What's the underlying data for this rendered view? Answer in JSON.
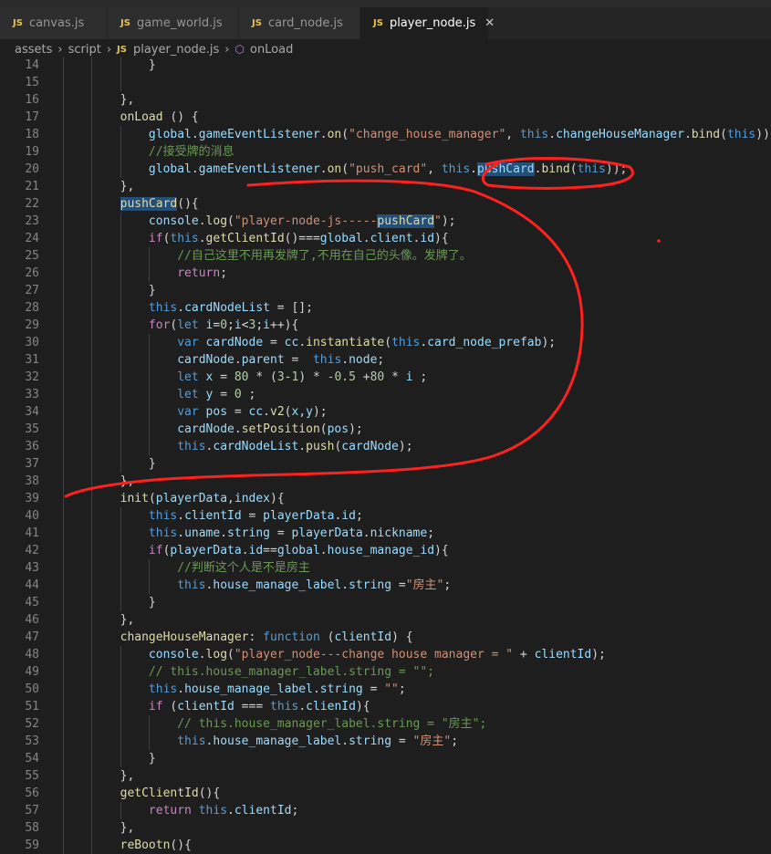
{
  "tabs": [
    {
      "icon": "JS",
      "label": "canvas.js"
    },
    {
      "icon": "JS",
      "label": "game_world.js"
    },
    {
      "icon": "JS",
      "label": "card_node.js"
    },
    {
      "icon": "JS",
      "label": "player_node.js",
      "active": true
    }
  ],
  "breadcrumb": [
    "assets",
    "script",
    "player_node.js",
    "onLoad"
  ],
  "colors": {
    "keyword": "#569cd6",
    "string": "#ce9178",
    "comment": "#6a9955",
    "function": "#dcdcaa",
    "variable": "#9cdcfe",
    "selection": "#264f78",
    "annotation": "#ff2020"
  },
  "lines": [
    {
      "n": "14",
      "t": [
        [
          "            ",
          "p"
        ],
        [
          "}",
          "p"
        ]
      ]
    },
    {
      "n": "15",
      "t": []
    },
    {
      "n": "16",
      "t": [
        [
          "        ",
          "p"
        ],
        [
          "},",
          "p"
        ]
      ]
    },
    {
      "n": "17",
      "t": [
        [
          "        ",
          "p"
        ],
        [
          "onLoad",
          "f"
        ],
        [
          " () {",
          "p"
        ]
      ]
    },
    {
      "n": "18",
      "t": [
        [
          "            ",
          "p"
        ],
        [
          "global",
          "v"
        ],
        [
          ".",
          "p"
        ],
        [
          "gameEventListener",
          "v"
        ],
        [
          ".",
          "p"
        ],
        [
          "on",
          "f"
        ],
        [
          "(",
          "p"
        ],
        [
          "\"change_house_manager\"",
          "s"
        ],
        [
          ", ",
          "p"
        ],
        [
          "this",
          "k"
        ],
        [
          ".",
          "p"
        ],
        [
          "changeHouseManager",
          "v"
        ],
        [
          ".",
          "p"
        ],
        [
          "bind",
          "f"
        ],
        [
          "(",
          "p"
        ],
        [
          "this",
          "k"
        ],
        [
          "));",
          "p"
        ]
      ]
    },
    {
      "n": "19",
      "t": [
        [
          "            ",
          "p"
        ],
        [
          "//接受牌的消息",
          "c"
        ]
      ]
    },
    {
      "n": "20",
      "t": [
        [
          "            ",
          "p"
        ],
        [
          "global",
          "v"
        ],
        [
          ".",
          "p"
        ],
        [
          "gameEventListener",
          "v"
        ],
        [
          ".",
          "p"
        ],
        [
          "on",
          "f"
        ],
        [
          "(",
          "p"
        ],
        [
          "\"push_card\"",
          "s"
        ],
        [
          ", ",
          "p"
        ],
        [
          "this",
          "k"
        ],
        [
          ".",
          "p"
        ],
        [
          "pushCard",
          "vh"
        ],
        [
          ".",
          "p"
        ],
        [
          "bind",
          "f"
        ],
        [
          "(",
          "p"
        ],
        [
          "this",
          "k"
        ],
        [
          "));",
          "p"
        ]
      ]
    },
    {
      "n": "21",
      "t": [
        [
          "        ",
          "p"
        ],
        [
          "},",
          "p"
        ]
      ]
    },
    {
      "n": "22",
      "t": [
        [
          "        ",
          "p"
        ],
        [
          "pushCard",
          "fh"
        ],
        [
          "(){",
          "p"
        ]
      ]
    },
    {
      "n": "23",
      "t": [
        [
          "            ",
          "p"
        ],
        [
          "console",
          "v"
        ],
        [
          ".",
          "p"
        ],
        [
          "log",
          "f"
        ],
        [
          "(",
          "p"
        ],
        [
          "\"player-node-js-----",
          "s"
        ],
        [
          "pushCard",
          "sh"
        ],
        [
          "\"",
          "s"
        ],
        [
          ");",
          "p"
        ]
      ]
    },
    {
      "n": "24",
      "t": [
        [
          "            ",
          "p"
        ],
        [
          "if",
          "x"
        ],
        [
          "(",
          "p"
        ],
        [
          "this",
          "k"
        ],
        [
          ".",
          "p"
        ],
        [
          "getClientId",
          "f"
        ],
        [
          "()===",
          "p"
        ],
        [
          "global",
          "v"
        ],
        [
          ".",
          "p"
        ],
        [
          "client",
          "v"
        ],
        [
          ".",
          "p"
        ],
        [
          "id",
          "v"
        ],
        [
          "){",
          "p"
        ]
      ]
    },
    {
      "n": "25",
      "t": [
        [
          "                ",
          "p"
        ],
        [
          "//自己这里不用再发牌了,不用在自己的头像。发牌了。",
          "c"
        ]
      ]
    },
    {
      "n": "26",
      "t": [
        [
          "                ",
          "p"
        ],
        [
          "return",
          "x"
        ],
        [
          ";",
          "p"
        ]
      ]
    },
    {
      "n": "27",
      "t": [
        [
          "            ",
          "p"
        ],
        [
          "}",
          "p"
        ]
      ]
    },
    {
      "n": "28",
      "t": [
        [
          "            ",
          "p"
        ],
        [
          "this",
          "k"
        ],
        [
          ".",
          "p"
        ],
        [
          "cardNodeList",
          "v"
        ],
        [
          " = [];",
          "p"
        ]
      ]
    },
    {
      "n": "29",
      "t": [
        [
          "            ",
          "p"
        ],
        [
          "for",
          "x"
        ],
        [
          "(",
          "p"
        ],
        [
          "let",
          "k"
        ],
        [
          " ",
          "p"
        ],
        [
          "i",
          "v"
        ],
        [
          "=",
          "p"
        ],
        [
          "0",
          "n"
        ],
        [
          ";",
          "p"
        ],
        [
          "i",
          "v"
        ],
        [
          "<",
          "p"
        ],
        [
          "3",
          "n"
        ],
        [
          ";",
          "p"
        ],
        [
          "i",
          "v"
        ],
        [
          "++){",
          "p"
        ]
      ]
    },
    {
      "n": "30",
      "t": [
        [
          "                ",
          "p"
        ],
        [
          "var",
          "k"
        ],
        [
          " ",
          "p"
        ],
        [
          "cardNode",
          "v"
        ],
        [
          " = ",
          "p"
        ],
        [
          "cc",
          "v"
        ],
        [
          ".",
          "p"
        ],
        [
          "instantiate",
          "f"
        ],
        [
          "(",
          "p"
        ],
        [
          "this",
          "k"
        ],
        [
          ".",
          "p"
        ],
        [
          "card_node_prefab",
          "v"
        ],
        [
          ");",
          "p"
        ]
      ]
    },
    {
      "n": "31",
      "t": [
        [
          "                ",
          "p"
        ],
        [
          "cardNode",
          "v"
        ],
        [
          ".",
          "p"
        ],
        [
          "parent",
          "v"
        ],
        [
          " =  ",
          "p"
        ],
        [
          "this",
          "k"
        ],
        [
          ".",
          "p"
        ],
        [
          "node",
          "v"
        ],
        [
          ";",
          "p"
        ]
      ]
    },
    {
      "n": "32",
      "t": [
        [
          "                ",
          "p"
        ],
        [
          "let",
          "k"
        ],
        [
          " ",
          "p"
        ],
        [
          "x",
          "v"
        ],
        [
          " = ",
          "p"
        ],
        [
          "80",
          "n"
        ],
        [
          " * (",
          "p"
        ],
        [
          "3",
          "n"
        ],
        [
          "-",
          "p"
        ],
        [
          "1",
          "n"
        ],
        [
          ") * ",
          "p"
        ],
        [
          "-0.5",
          "n"
        ],
        [
          " +",
          "p"
        ],
        [
          "80",
          "n"
        ],
        [
          " * ",
          "p"
        ],
        [
          "i",
          "v"
        ],
        [
          " ;",
          "p"
        ]
      ]
    },
    {
      "n": "33",
      "t": [
        [
          "                ",
          "p"
        ],
        [
          "let",
          "k"
        ],
        [
          " ",
          "p"
        ],
        [
          "y",
          "v"
        ],
        [
          " = ",
          "p"
        ],
        [
          "0",
          "n"
        ],
        [
          " ;",
          "p"
        ]
      ]
    },
    {
      "n": "34",
      "t": [
        [
          "                ",
          "p"
        ],
        [
          "var",
          "k"
        ],
        [
          " ",
          "p"
        ],
        [
          "pos",
          "v"
        ],
        [
          " = ",
          "p"
        ],
        [
          "cc",
          "v"
        ],
        [
          ".",
          "p"
        ],
        [
          "v2",
          "f"
        ],
        [
          "(",
          "p"
        ],
        [
          "x",
          "v"
        ],
        [
          ",",
          "p"
        ],
        [
          "y",
          "v"
        ],
        [
          ");",
          "p"
        ]
      ]
    },
    {
      "n": "35",
      "t": [
        [
          "                ",
          "p"
        ],
        [
          "cardNode",
          "v"
        ],
        [
          ".",
          "p"
        ],
        [
          "setPosition",
          "f"
        ],
        [
          "(",
          "p"
        ],
        [
          "pos",
          "v"
        ],
        [
          ");",
          "p"
        ]
      ]
    },
    {
      "n": "36",
      "t": [
        [
          "                ",
          "p"
        ],
        [
          "this",
          "k"
        ],
        [
          ".",
          "p"
        ],
        [
          "cardNodeList",
          "v"
        ],
        [
          ".",
          "p"
        ],
        [
          "push",
          "f"
        ],
        [
          "(",
          "p"
        ],
        [
          "cardNode",
          "v"
        ],
        [
          ");",
          "p"
        ]
      ]
    },
    {
      "n": "37",
      "t": [
        [
          "            ",
          "p"
        ],
        [
          "}",
          "p"
        ]
      ]
    },
    {
      "n": "38",
      "t": [
        [
          "        ",
          "p"
        ],
        [
          "},",
          "p"
        ]
      ]
    },
    {
      "n": "39",
      "t": [
        [
          "        ",
          "p"
        ],
        [
          "init",
          "f"
        ],
        [
          "(",
          "p"
        ],
        [
          "playerData",
          "v"
        ],
        [
          ",",
          "p"
        ],
        [
          "index",
          "v"
        ],
        [
          "){",
          "p"
        ]
      ]
    },
    {
      "n": "40",
      "t": [
        [
          "            ",
          "p"
        ],
        [
          "this",
          "k"
        ],
        [
          ".",
          "p"
        ],
        [
          "clientId",
          "v"
        ],
        [
          " = ",
          "p"
        ],
        [
          "playerData",
          "v"
        ],
        [
          ".",
          "p"
        ],
        [
          "id",
          "v"
        ],
        [
          ";",
          "p"
        ]
      ]
    },
    {
      "n": "41",
      "t": [
        [
          "            ",
          "p"
        ],
        [
          "this",
          "k"
        ],
        [
          ".",
          "p"
        ],
        [
          "uname",
          "v"
        ],
        [
          ".",
          "p"
        ],
        [
          "string",
          "v"
        ],
        [
          " = ",
          "p"
        ],
        [
          "playerData",
          "v"
        ],
        [
          ".",
          "p"
        ],
        [
          "nickname",
          "v"
        ],
        [
          ";",
          "p"
        ]
      ]
    },
    {
      "n": "42",
      "t": [
        [
          "            ",
          "p"
        ],
        [
          "if",
          "x"
        ],
        [
          "(",
          "p"
        ],
        [
          "playerData",
          "v"
        ],
        [
          ".",
          "p"
        ],
        [
          "id",
          "v"
        ],
        [
          "==",
          "p"
        ],
        [
          "global",
          "v"
        ],
        [
          ".",
          "p"
        ],
        [
          "house_manage_id",
          "v"
        ],
        [
          "){",
          "p"
        ]
      ]
    },
    {
      "n": "43",
      "t": [
        [
          "                ",
          "p"
        ],
        [
          "//判断这个人是不是房主",
          "c"
        ]
      ]
    },
    {
      "n": "44",
      "t": [
        [
          "                ",
          "p"
        ],
        [
          "this",
          "k"
        ],
        [
          ".",
          "p"
        ],
        [
          "house_manage_label",
          "v"
        ],
        [
          ".",
          "p"
        ],
        [
          "string",
          "v"
        ],
        [
          " =",
          "p"
        ],
        [
          "\"房主\"",
          "s"
        ],
        [
          ";",
          "p"
        ]
      ]
    },
    {
      "n": "45",
      "t": [
        [
          "            ",
          "p"
        ],
        [
          "}",
          "p"
        ]
      ]
    },
    {
      "n": "46",
      "t": [
        [
          "        ",
          "p"
        ],
        [
          "},",
          "p"
        ]
      ]
    },
    {
      "n": "47",
      "t": [
        [
          "        ",
          "p"
        ],
        [
          "changeHouseManager",
          "f"
        ],
        [
          ": ",
          "p"
        ],
        [
          "function",
          "k"
        ],
        [
          " (",
          "p"
        ],
        [
          "clientId",
          "v"
        ],
        [
          ") {",
          "p"
        ]
      ]
    },
    {
      "n": "48",
      "t": [
        [
          "            ",
          "p"
        ],
        [
          "console",
          "v"
        ],
        [
          ".",
          "p"
        ],
        [
          "log",
          "f"
        ],
        [
          "(",
          "p"
        ],
        [
          "\"player_node---change house manager = \"",
          "s"
        ],
        [
          " + ",
          "p"
        ],
        [
          "clientId",
          "v"
        ],
        [
          ");",
          "p"
        ]
      ]
    },
    {
      "n": "49",
      "t": [
        [
          "            ",
          "p"
        ],
        [
          "// this.house_manager_label.string = \"\";",
          "c"
        ]
      ]
    },
    {
      "n": "50",
      "t": [
        [
          "            ",
          "p"
        ],
        [
          "this",
          "k"
        ],
        [
          ".",
          "p"
        ],
        [
          "house_manage_label",
          "v"
        ],
        [
          ".",
          "p"
        ],
        [
          "string",
          "v"
        ],
        [
          " = ",
          "p"
        ],
        [
          "\"\"",
          "s"
        ],
        [
          ";",
          "p"
        ]
      ]
    },
    {
      "n": "51",
      "t": [
        [
          "            ",
          "p"
        ],
        [
          "if",
          "x"
        ],
        [
          " (",
          "p"
        ],
        [
          "clientId",
          "v"
        ],
        [
          " === ",
          "p"
        ],
        [
          "this",
          "k"
        ],
        [
          ".",
          "p"
        ],
        [
          "clienId",
          "v"
        ],
        [
          "){",
          "p"
        ]
      ]
    },
    {
      "n": "52",
      "t": [
        [
          "                ",
          "p"
        ],
        [
          "// this.house_manager_label.string = \"房主\";",
          "c"
        ]
      ]
    },
    {
      "n": "53",
      "t": [
        [
          "                ",
          "p"
        ],
        [
          "this",
          "k"
        ],
        [
          ".",
          "p"
        ],
        [
          "house_manage_label",
          "v"
        ],
        [
          ".",
          "p"
        ],
        [
          "string",
          "v"
        ],
        [
          " = ",
          "p"
        ],
        [
          "\"房主\"",
          "s"
        ],
        [
          ";",
          "p"
        ]
      ]
    },
    {
      "n": "54",
      "t": [
        [
          "            ",
          "p"
        ],
        [
          "}",
          "p"
        ]
      ]
    },
    {
      "n": "55",
      "t": [
        [
          "        ",
          "p"
        ],
        [
          "},",
          "p"
        ]
      ]
    },
    {
      "n": "56",
      "t": [
        [
          "        ",
          "p"
        ],
        [
          "getClientId",
          "f"
        ],
        [
          "(){",
          "p"
        ]
      ]
    },
    {
      "n": "57",
      "t": [
        [
          "            ",
          "p"
        ],
        [
          "return",
          "x"
        ],
        [
          " ",
          "p"
        ],
        [
          "this",
          "k"
        ],
        [
          ".",
          "p"
        ],
        [
          "clientId",
          "v"
        ],
        [
          ";",
          "p"
        ]
      ]
    },
    {
      "n": "58",
      "t": [
        [
          "        ",
          "p"
        ],
        [
          "},",
          "p"
        ]
      ]
    },
    {
      "n": "59",
      "t": [
        [
          "        ",
          "p"
        ],
        [
          "reBootn",
          "f"
        ],
        [
          "(){",
          "p"
        ]
      ]
    }
  ]
}
